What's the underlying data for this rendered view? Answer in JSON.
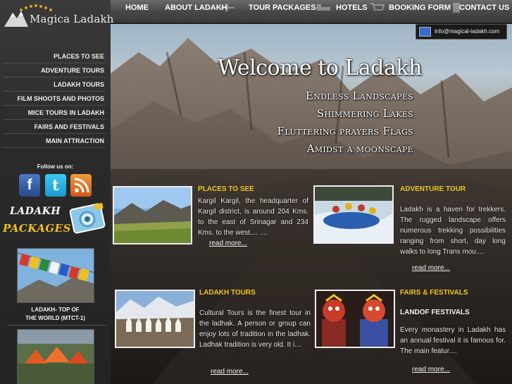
{
  "brand": {
    "name_part1": "Magica",
    "name_part2": "Ladakh",
    "email": "info@magical-ladakh.com"
  },
  "topnav": [
    {
      "label": "HOME"
    },
    {
      "label": "ABOUT LADAKH"
    },
    {
      "label": "TOUR PACKAGES"
    },
    {
      "label": "HOTELS"
    },
    {
      "label": "BOOKING FORM"
    },
    {
      "label": "CONTACT US"
    }
  ],
  "sidebar": {
    "items": [
      {
        "label": "PLACES TO SEE"
      },
      {
        "label": "ADVENTURE TOURS"
      },
      {
        "label": "LADAKH TOURS"
      },
      {
        "label": "FILM SHOOTS AND PHOTOS"
      },
      {
        "label": "MICE TOURS IN LADAKH"
      },
      {
        "label": "FAIRS AND FESTIVALS"
      },
      {
        "label": "MAIN ATTRACTION"
      }
    ],
    "follow_label": "Follow us on:",
    "social": {
      "facebook": "f",
      "twitter": "t",
      "rss": "RSS"
    },
    "banner_line1": "LADAKH",
    "banner_line2": "PACKAGES",
    "package1_caption_line1": "LADAKH- TOP OF",
    "package1_caption_line2": "THE WORLD (MTCT-1)"
  },
  "hero": {
    "title": "Welcome to Ladakh",
    "taglines": [
      "Endless Landscapes",
      "Shimmering Lakes",
      "Fluttering prayers Flags",
      "Amidst a moonscape"
    ]
  },
  "cards": [
    {
      "title": "PLACES TO SEE",
      "subtitle": "",
      "text": "Kargil Kargil, the headquarter of Kargil district, is around 204 Kms. to the east of Srinagar and 234 Kms. to the west.... ....",
      "more": "read more..."
    },
    {
      "title": "ADVENTURE TOUR",
      "subtitle": "",
      "text": "Ladakh is a haven for trekkers. The rugged landscape offers numerous trekking possibilities ranging from short, day long walks to long Trans mou....",
      "more": "read more..."
    },
    {
      "title": "LADAKH TOURS",
      "subtitle": "",
      "text": "Cultural Tours is the finest tour in the ladhak. A person or group can enjoy lots of tradition in the ladhak. Ladhak tradition is very old. It i....",
      "more": "read more..."
    },
    {
      "title": "FAIRS & FESTIVALS",
      "subtitle": "LANDOF FESTIVALS",
      "text": "Every monastery in Ladakh has an annual festival it is famous for. The main featur....",
      "more": "read more..."
    }
  ],
  "colors": {
    "accent": "#f0c419",
    "nav_bg": "#484848",
    "sidebar_bg": "#2a2a2a"
  }
}
